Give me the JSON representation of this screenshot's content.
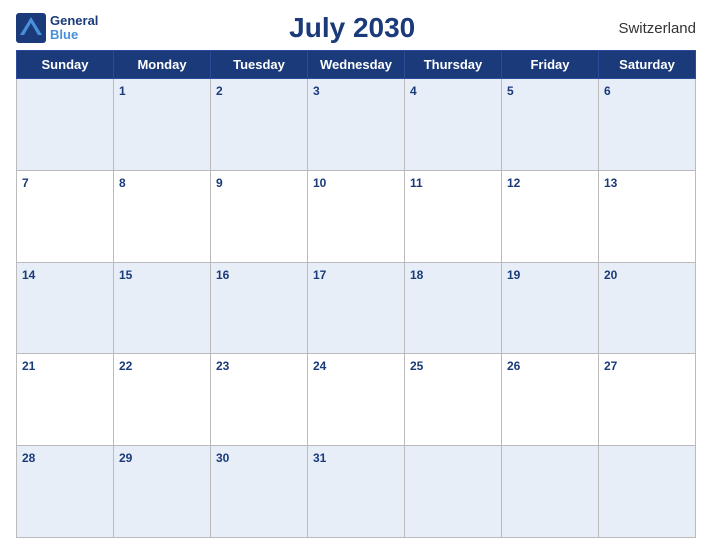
{
  "header": {
    "title": "July 2030",
    "country": "Switzerland",
    "logo": {
      "line1": "General",
      "line2": "Blue"
    }
  },
  "weekdays": [
    "Sunday",
    "Monday",
    "Tuesday",
    "Wednesday",
    "Thursday",
    "Friday",
    "Saturday"
  ],
  "weeks": [
    [
      null,
      1,
      2,
      3,
      4,
      5,
      6
    ],
    [
      7,
      8,
      9,
      10,
      11,
      12,
      13
    ],
    [
      14,
      15,
      16,
      17,
      18,
      19,
      20
    ],
    [
      21,
      22,
      23,
      24,
      25,
      26,
      27
    ],
    [
      28,
      29,
      30,
      31,
      null,
      null,
      null
    ]
  ]
}
